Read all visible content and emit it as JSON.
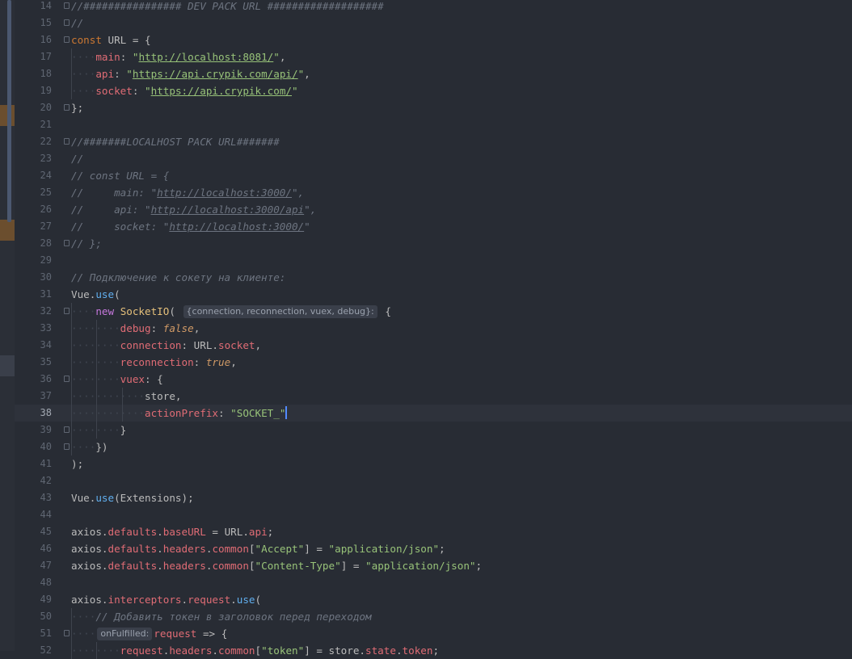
{
  "lines": [
    {
      "n": "14",
      "fold": true,
      "tokens": [
        [
          "cm",
          "//################ DEV PACK URL ###################"
        ]
      ]
    },
    {
      "n": "15",
      "fold": true,
      "tokens": [
        [
          "cm",
          "//"
        ]
      ]
    },
    {
      "n": "16",
      "fold": true,
      "tokens": [
        [
          "kw",
          "const"
        ],
        [
          "id",
          " URL = {"
        ]
      ]
    },
    {
      "n": "17",
      "guides": [
        88
      ],
      "tokens": [
        [
          "ws",
          "····"
        ],
        [
          "prop",
          "main"
        ],
        [
          "id",
          ": "
        ],
        [
          "str",
          "\""
        ],
        [
          "url",
          "http://localhost:8081/"
        ],
        [
          "str",
          "\""
        ],
        [
          "id",
          ","
        ]
      ]
    },
    {
      "n": "18",
      "guides": [
        88
      ],
      "tokens": [
        [
          "ws",
          "····"
        ],
        [
          "prop",
          "api"
        ],
        [
          "id",
          ": "
        ],
        [
          "str",
          "\""
        ],
        [
          "url",
          "https://api.crypik.com/api/"
        ],
        [
          "str",
          "\""
        ],
        [
          "id",
          ","
        ]
      ]
    },
    {
      "n": "19",
      "guides": [
        88
      ],
      "tokens": [
        [
          "ws",
          "····"
        ],
        [
          "prop",
          "socket"
        ],
        [
          "id",
          ": "
        ],
        [
          "str",
          "\""
        ],
        [
          "url",
          "https://api.crypik.com/"
        ],
        [
          "str",
          "\""
        ]
      ]
    },
    {
      "n": "20",
      "fold": true,
      "tokens": [
        [
          "id",
          "};"
        ]
      ]
    },
    {
      "n": "21",
      "tokens": []
    },
    {
      "n": "22",
      "fold": true,
      "tokens": [
        [
          "cm",
          "//#######LOCALHOST PACK URL#######"
        ]
      ]
    },
    {
      "n": "23",
      "tokens": [
        [
          "cm",
          "//"
        ]
      ]
    },
    {
      "n": "24",
      "tokens": [
        [
          "cm",
          "// const URL = {"
        ]
      ]
    },
    {
      "n": "25",
      "tokens": [
        [
          "cm",
          "//     main: \""
        ],
        [
          "cmurl",
          "http://localhost:3000/"
        ],
        [
          "cm",
          "\","
        ]
      ]
    },
    {
      "n": "26",
      "tokens": [
        [
          "cm",
          "//     api: \""
        ],
        [
          "cmurl",
          "http://localhost:3000/api"
        ],
        [
          "cm",
          "\","
        ]
      ]
    },
    {
      "n": "27",
      "tokens": [
        [
          "cm",
          "//     socket: \""
        ],
        [
          "cmurl",
          "http://localhost:3000/"
        ],
        [
          "cm",
          "\""
        ]
      ]
    },
    {
      "n": "28",
      "fold": true,
      "tokens": [
        [
          "cm",
          "// };"
        ]
      ]
    },
    {
      "n": "29",
      "tokens": []
    },
    {
      "n": "30",
      "tokens": [
        [
          "cm",
          "// Подключение к сокету на клиенте:"
        ]
      ]
    },
    {
      "n": "31",
      "tokens": [
        [
          "id",
          "Vue."
        ],
        [
          "fn",
          "use"
        ],
        [
          "id",
          "("
        ]
      ]
    },
    {
      "n": "32",
      "fold": true,
      "guides": [
        88
      ],
      "tokens": [
        [
          "ws",
          "····"
        ],
        [
          "kw2",
          "new "
        ],
        [
          "cls",
          "SocketIO"
        ],
        [
          "id",
          "( "
        ],
        [
          "hint",
          "{connection, reconnection, vuex, debug}:"
        ],
        [
          "id",
          " {"
        ]
      ]
    },
    {
      "n": "33",
      "guides": [
        88,
        119
      ],
      "tokens": [
        [
          "ws",
          "········"
        ],
        [
          "prop",
          "debug"
        ],
        [
          "id",
          ": "
        ],
        [
          "bool",
          "false"
        ],
        [
          "id",
          ","
        ]
      ]
    },
    {
      "n": "34",
      "guides": [
        88,
        119
      ],
      "tokens": [
        [
          "ws",
          "········"
        ],
        [
          "prop",
          "connection"
        ],
        [
          "id",
          ": URL."
        ],
        [
          "prop",
          "socket"
        ],
        [
          "id",
          ","
        ]
      ]
    },
    {
      "n": "35",
      "guides": [
        88,
        119
      ],
      "tokens": [
        [
          "ws",
          "········"
        ],
        [
          "prop",
          "reconnection"
        ],
        [
          "id",
          ": "
        ],
        [
          "bool",
          "true"
        ],
        [
          "id",
          ","
        ]
      ]
    },
    {
      "n": "36",
      "fold": true,
      "guides": [
        88,
        119
      ],
      "tokens": [
        [
          "ws",
          "········"
        ],
        [
          "prop",
          "vuex"
        ],
        [
          "id",
          ": {"
        ]
      ]
    },
    {
      "n": "37",
      "guides": [
        88,
        119,
        151
      ],
      "tokens": [
        [
          "ws",
          "············"
        ],
        [
          "id",
          "store,"
        ]
      ]
    },
    {
      "n": "38",
      "active": true,
      "guides": [
        88,
        119,
        151
      ],
      "tokens": [
        [
          "ws",
          "············"
        ],
        [
          "prop",
          "actionPrefix"
        ],
        [
          "id",
          ": "
        ],
        [
          "str",
          "\"SOCKET_\""
        ],
        [
          "caret",
          ""
        ]
      ]
    },
    {
      "n": "39",
      "fold": true,
      "guides": [
        88,
        119
      ],
      "tokens": [
        [
          "ws",
          "········"
        ],
        [
          "id",
          "}"
        ]
      ]
    },
    {
      "n": "40",
      "fold": true,
      "guides": [
        88
      ],
      "tokens": [
        [
          "ws",
          "····"
        ],
        [
          "id",
          "})"
        ]
      ]
    },
    {
      "n": "41",
      "tokens": [
        [
          "id",
          ");"
        ]
      ]
    },
    {
      "n": "42",
      "tokens": []
    },
    {
      "n": "43",
      "tokens": [
        [
          "id",
          "Vue."
        ],
        [
          "fn",
          "use"
        ],
        [
          "id",
          "(Extensions);"
        ]
      ]
    },
    {
      "n": "44",
      "tokens": []
    },
    {
      "n": "45",
      "tokens": [
        [
          "id",
          "axios."
        ],
        [
          "prop",
          "defaults"
        ],
        [
          "id",
          "."
        ],
        [
          "prop",
          "baseURL"
        ],
        [
          "id",
          " = URL."
        ],
        [
          "prop",
          "api"
        ],
        [
          "id",
          ";"
        ]
      ]
    },
    {
      "n": "46",
      "tokens": [
        [
          "id",
          "axios."
        ],
        [
          "prop",
          "defaults"
        ],
        [
          "id",
          "."
        ],
        [
          "prop",
          "headers"
        ],
        [
          "id",
          "."
        ],
        [
          "prop",
          "common"
        ],
        [
          "id",
          "["
        ],
        [
          "str",
          "\"Accept\""
        ],
        [
          "id",
          "] = "
        ],
        [
          "str",
          "\"application/json\""
        ],
        [
          "id",
          ";"
        ]
      ]
    },
    {
      "n": "47",
      "tokens": [
        [
          "id",
          "axios."
        ],
        [
          "prop",
          "defaults"
        ],
        [
          "id",
          "."
        ],
        [
          "prop",
          "headers"
        ],
        [
          "id",
          "."
        ],
        [
          "prop",
          "common"
        ],
        [
          "id",
          "["
        ],
        [
          "str",
          "\"Content-Type\""
        ],
        [
          "id",
          "] = "
        ],
        [
          "str",
          "\"application/json\""
        ],
        [
          "id",
          ";"
        ]
      ]
    },
    {
      "n": "48",
      "tokens": []
    },
    {
      "n": "49",
      "tokens": [
        [
          "id",
          "axios."
        ],
        [
          "prop",
          "interceptors"
        ],
        [
          "id",
          "."
        ],
        [
          "prop",
          "request"
        ],
        [
          "id",
          "."
        ],
        [
          "fn",
          "use"
        ],
        [
          "id",
          "("
        ]
      ]
    },
    {
      "n": "50",
      "guides": [
        88
      ],
      "tokens": [
        [
          "ws",
          "····"
        ],
        [
          "cm",
          "// Добавить токен в заголовок перед переходом"
        ]
      ]
    },
    {
      "n": "51",
      "fold": true,
      "guides": [
        88
      ],
      "tokens": [
        [
          "ws",
          "····"
        ],
        [
          "hint",
          "onFulfilled:"
        ],
        [
          "prop",
          "request"
        ],
        [
          "id",
          " => {"
        ]
      ]
    },
    {
      "n": "52",
      "guides": [
        88,
        119
      ],
      "tokens": [
        [
          "ws",
          "········"
        ],
        [
          "prop",
          "request"
        ],
        [
          "id",
          "."
        ],
        [
          "prop",
          "headers"
        ],
        [
          "id",
          "."
        ],
        [
          "prop",
          "common"
        ],
        [
          "id",
          "["
        ],
        [
          "str",
          "\"token\""
        ],
        [
          "id",
          "] = store."
        ],
        [
          "prop",
          "state"
        ],
        [
          "id",
          "."
        ],
        [
          "prop",
          "token"
        ],
        [
          "id",
          ";"
        ]
      ]
    }
  ]
}
